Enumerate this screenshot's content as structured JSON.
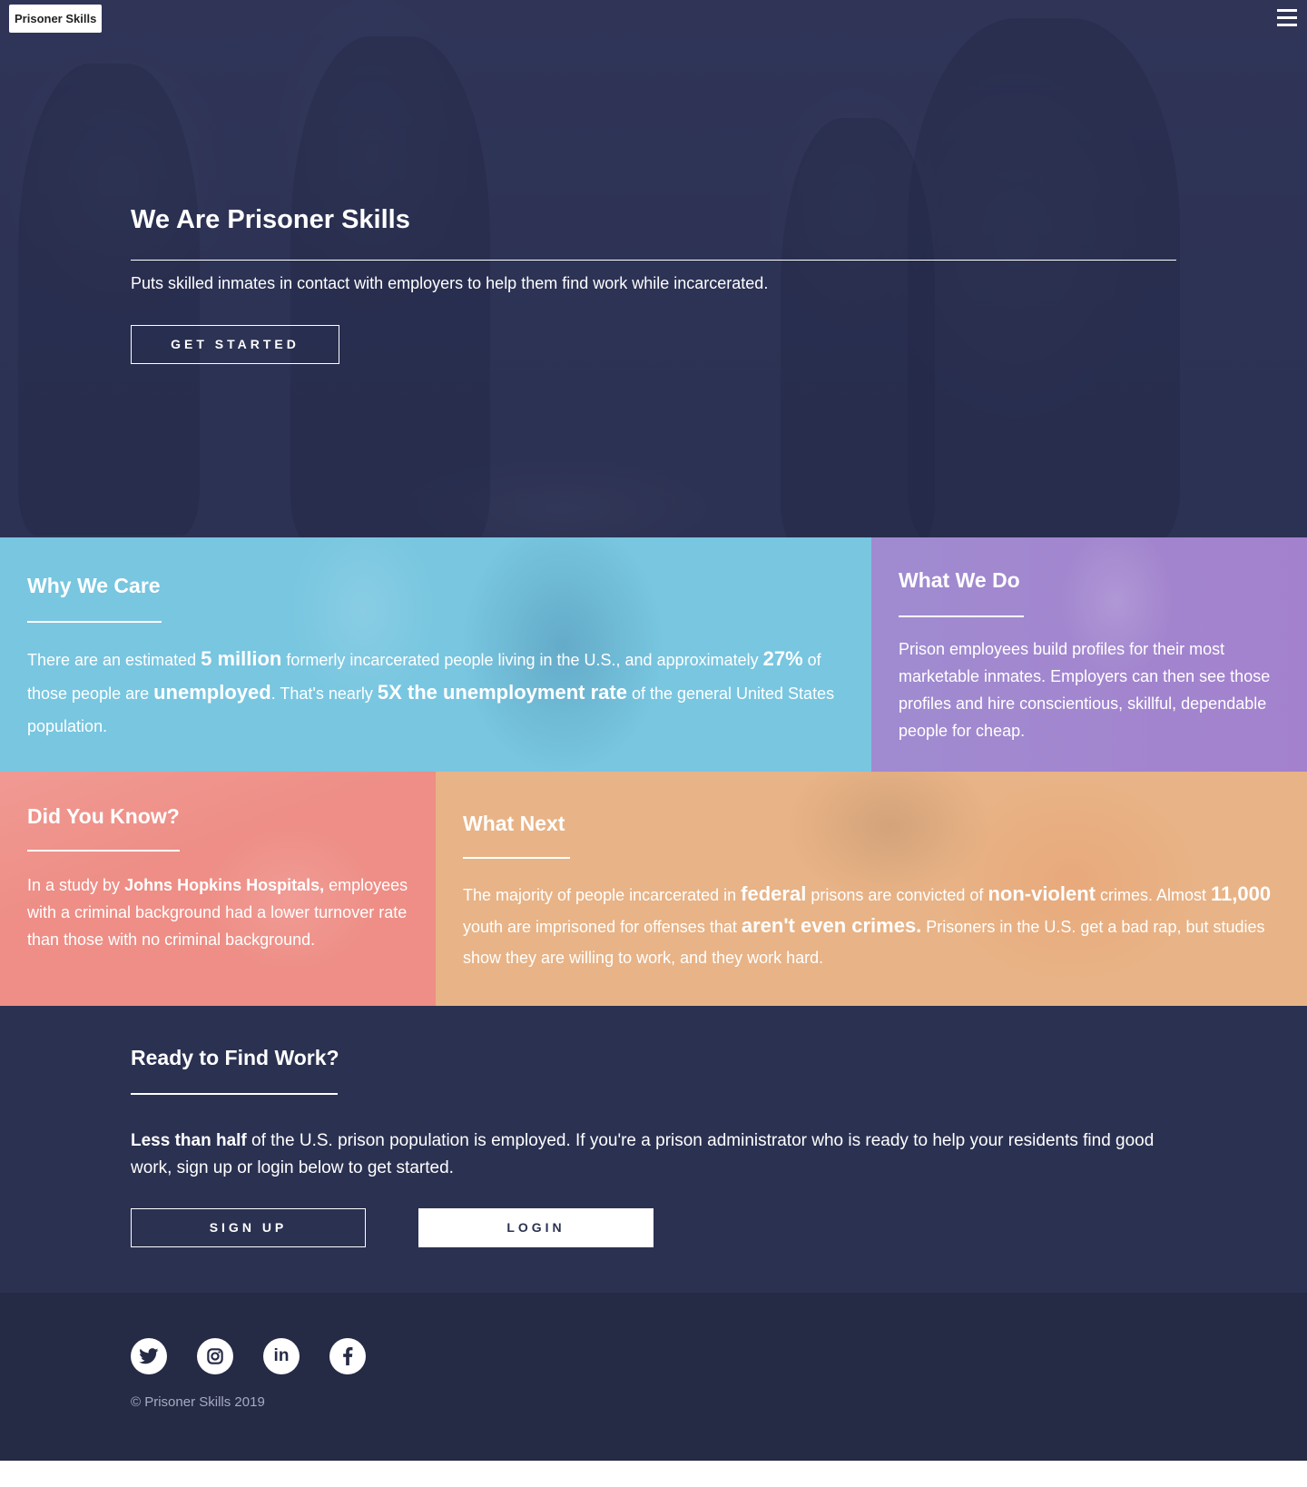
{
  "header": {
    "brand": "Prisoner Skills",
    "menu_icon": "hamburger-menu-icon"
  },
  "hero": {
    "title": "We Are Prisoner Skills",
    "subtitle": "Puts skilled inmates in contact with employers to help them find work while incarcerated.",
    "cta_label": "GET STARTED"
  },
  "tiles": {
    "why": {
      "title": "Why We Care",
      "t1": "There are an estimated ",
      "b1": "5 million",
      "t2": " formerly incarcerated people living in the U.S., and approximately ",
      "b2": "27%",
      "t3": " of those people are ",
      "b3": "unemployed",
      "t4": ". That's nearly ",
      "b4": "5X the unemployment rate",
      "t5": " of the general United States population."
    },
    "what_do": {
      "title": "What We Do",
      "text": "Prison employees build profiles for their most marketable inmates. Employers can then see those profiles and hire conscientious, skillful, dependable people for cheap."
    },
    "know": {
      "title": "Did You Know?",
      "t1": "In a study by ",
      "b1": "Johns Hopkins Hospitals,",
      "t2": " employees with a criminal background had a lower turnover rate than those with no criminal background."
    },
    "next": {
      "title": "What Next",
      "t1": "The majority of people incarcerated in ",
      "b1": "federal",
      "t2": " prisons are convicted of ",
      "b2": "non-violent",
      "t3": " crimes. Almost ",
      "b3": "11,000",
      "t4": " youth are imprisoned for offenses that ",
      "b4": "aren't even crimes.",
      "t5": " Prisoners in the U.S. get a bad rap, but studies show they are willing to work, and they work hard."
    }
  },
  "ready": {
    "title": "Ready to Find Work?",
    "bold": "Less than half",
    "text": " of the U.S. prison population is employed. If you're a prison administrator who is ready to help your residents find good work, sign up or login below to get started.",
    "signup_label": "SIGN UP",
    "login_label": "LOGIN"
  },
  "footer": {
    "social": [
      "twitter-icon",
      "instagram-icon",
      "linkedin-icon",
      "facebook-icon"
    ],
    "copyright": "© Prisoner Skills 2019"
  },
  "colors": {
    "navy": "#2b3151",
    "footer": "#252a45",
    "blue_tile": "#78c6e0",
    "purple_tile": "#a08bd0",
    "salmon_tile": "#ee8e86",
    "orange_tile": "#e8b386"
  }
}
